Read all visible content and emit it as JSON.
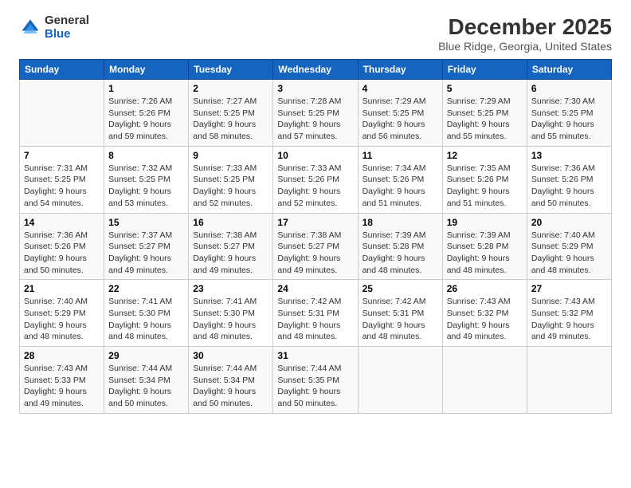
{
  "logo": {
    "general": "General",
    "blue": "Blue"
  },
  "header": {
    "title": "December 2025",
    "subtitle": "Blue Ridge, Georgia, United States"
  },
  "weekdays": [
    "Sunday",
    "Monday",
    "Tuesday",
    "Wednesday",
    "Thursday",
    "Friday",
    "Saturday"
  ],
  "weeks": [
    [
      {
        "day": "",
        "info": ""
      },
      {
        "day": "1",
        "info": "Sunrise: 7:26 AM\nSunset: 5:26 PM\nDaylight: 9 hours\nand 59 minutes."
      },
      {
        "day": "2",
        "info": "Sunrise: 7:27 AM\nSunset: 5:25 PM\nDaylight: 9 hours\nand 58 minutes."
      },
      {
        "day": "3",
        "info": "Sunrise: 7:28 AM\nSunset: 5:25 PM\nDaylight: 9 hours\nand 57 minutes."
      },
      {
        "day": "4",
        "info": "Sunrise: 7:29 AM\nSunset: 5:25 PM\nDaylight: 9 hours\nand 56 minutes."
      },
      {
        "day": "5",
        "info": "Sunrise: 7:29 AM\nSunset: 5:25 PM\nDaylight: 9 hours\nand 55 minutes."
      },
      {
        "day": "6",
        "info": "Sunrise: 7:30 AM\nSunset: 5:25 PM\nDaylight: 9 hours\nand 55 minutes."
      }
    ],
    [
      {
        "day": "7",
        "info": "Sunrise: 7:31 AM\nSunset: 5:25 PM\nDaylight: 9 hours\nand 54 minutes."
      },
      {
        "day": "8",
        "info": "Sunrise: 7:32 AM\nSunset: 5:25 PM\nDaylight: 9 hours\nand 53 minutes."
      },
      {
        "day": "9",
        "info": "Sunrise: 7:33 AM\nSunset: 5:25 PM\nDaylight: 9 hours\nand 52 minutes."
      },
      {
        "day": "10",
        "info": "Sunrise: 7:33 AM\nSunset: 5:26 PM\nDaylight: 9 hours\nand 52 minutes."
      },
      {
        "day": "11",
        "info": "Sunrise: 7:34 AM\nSunset: 5:26 PM\nDaylight: 9 hours\nand 51 minutes."
      },
      {
        "day": "12",
        "info": "Sunrise: 7:35 AM\nSunset: 5:26 PM\nDaylight: 9 hours\nand 51 minutes."
      },
      {
        "day": "13",
        "info": "Sunrise: 7:36 AM\nSunset: 5:26 PM\nDaylight: 9 hours\nand 50 minutes."
      }
    ],
    [
      {
        "day": "14",
        "info": "Sunrise: 7:36 AM\nSunset: 5:26 PM\nDaylight: 9 hours\nand 50 minutes."
      },
      {
        "day": "15",
        "info": "Sunrise: 7:37 AM\nSunset: 5:27 PM\nDaylight: 9 hours\nand 49 minutes."
      },
      {
        "day": "16",
        "info": "Sunrise: 7:38 AM\nSunset: 5:27 PM\nDaylight: 9 hours\nand 49 minutes."
      },
      {
        "day": "17",
        "info": "Sunrise: 7:38 AM\nSunset: 5:27 PM\nDaylight: 9 hours\nand 49 minutes."
      },
      {
        "day": "18",
        "info": "Sunrise: 7:39 AM\nSunset: 5:28 PM\nDaylight: 9 hours\nand 48 minutes."
      },
      {
        "day": "19",
        "info": "Sunrise: 7:39 AM\nSunset: 5:28 PM\nDaylight: 9 hours\nand 48 minutes."
      },
      {
        "day": "20",
        "info": "Sunrise: 7:40 AM\nSunset: 5:29 PM\nDaylight: 9 hours\nand 48 minutes."
      }
    ],
    [
      {
        "day": "21",
        "info": "Sunrise: 7:40 AM\nSunset: 5:29 PM\nDaylight: 9 hours\nand 48 minutes."
      },
      {
        "day": "22",
        "info": "Sunrise: 7:41 AM\nSunset: 5:30 PM\nDaylight: 9 hours\nand 48 minutes."
      },
      {
        "day": "23",
        "info": "Sunrise: 7:41 AM\nSunset: 5:30 PM\nDaylight: 9 hours\nand 48 minutes."
      },
      {
        "day": "24",
        "info": "Sunrise: 7:42 AM\nSunset: 5:31 PM\nDaylight: 9 hours\nand 48 minutes."
      },
      {
        "day": "25",
        "info": "Sunrise: 7:42 AM\nSunset: 5:31 PM\nDaylight: 9 hours\nand 48 minutes."
      },
      {
        "day": "26",
        "info": "Sunrise: 7:43 AM\nSunset: 5:32 PM\nDaylight: 9 hours\nand 49 minutes."
      },
      {
        "day": "27",
        "info": "Sunrise: 7:43 AM\nSunset: 5:32 PM\nDaylight: 9 hours\nand 49 minutes."
      }
    ],
    [
      {
        "day": "28",
        "info": "Sunrise: 7:43 AM\nSunset: 5:33 PM\nDaylight: 9 hours\nand 49 minutes."
      },
      {
        "day": "29",
        "info": "Sunrise: 7:44 AM\nSunset: 5:34 PM\nDaylight: 9 hours\nand 50 minutes."
      },
      {
        "day": "30",
        "info": "Sunrise: 7:44 AM\nSunset: 5:34 PM\nDaylight: 9 hours\nand 50 minutes."
      },
      {
        "day": "31",
        "info": "Sunrise: 7:44 AM\nSunset: 5:35 PM\nDaylight: 9 hours\nand 50 minutes."
      },
      {
        "day": "",
        "info": ""
      },
      {
        "day": "",
        "info": ""
      },
      {
        "day": "",
        "info": ""
      }
    ]
  ]
}
